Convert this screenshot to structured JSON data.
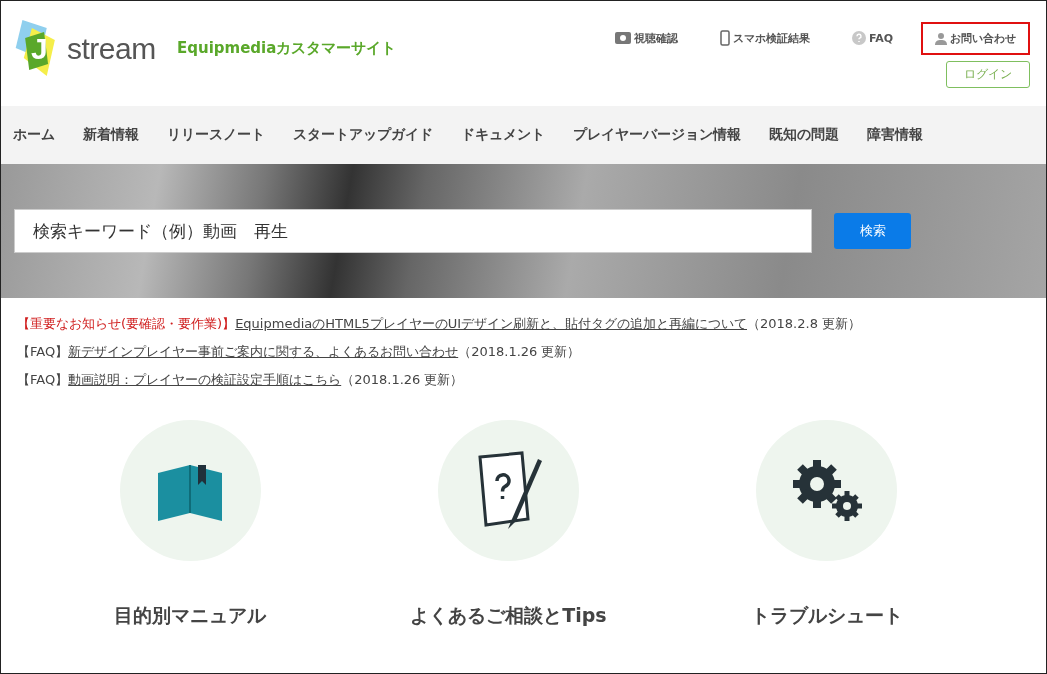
{
  "logo": {
    "mark": "J",
    "word": "stream"
  },
  "site_name": "Equipmediaカスタマーサイト",
  "top_links": [
    {
      "label": "視聴確認",
      "kind": "video",
      "highlighted": false
    },
    {
      "label": "スマホ検証結果",
      "kind": "phone",
      "highlighted": false
    },
    {
      "label": "FAQ",
      "kind": "help",
      "highlighted": false
    },
    {
      "label": "お問い合わせ",
      "kind": "person",
      "highlighted": true
    }
  ],
  "login_button": "ログイン",
  "nav": [
    "ホーム",
    "新着情報",
    "リリースノート",
    "スタートアップガイド",
    "ドキュメント",
    "プレイヤーバージョン情報",
    "既知の問題",
    "障害情報"
  ],
  "search": {
    "placeholder": "検索キーワード（例）動画　再生",
    "button": "検索"
  },
  "notices": [
    {
      "kind": "important",
      "tag": "【重要なお知らせ(要確認・要作業)】",
      "link": "EquipmediaのHTML5プレイヤーのUIデザイン刷新と、貼付タグの追加と再編について",
      "date": "（2018.2.8 更新）"
    },
    {
      "kind": "faq",
      "tag": "【FAQ】",
      "link": "新デザインプレイヤー事前ご案内に関する、よくあるお問い合わせ",
      "date": "（2018.1.26 更新）"
    },
    {
      "kind": "faq",
      "tag": "【FAQ】",
      "link": "動画説明：プレイヤーの検証設定手順はこちら",
      "date": "（2018.1.26 更新）"
    }
  ],
  "categories": [
    {
      "kind": "book",
      "title": "目的別マニュアル"
    },
    {
      "kind": "tips",
      "title": "よくあるご相談とTips"
    },
    {
      "kind": "gears",
      "title": "トラブルシュート"
    }
  ]
}
